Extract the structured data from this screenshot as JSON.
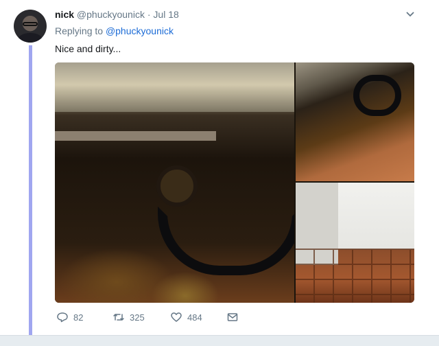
{
  "tweet": {
    "name": "nick",
    "handle": "@phuckyounick",
    "dot": "·",
    "date": "Jul 18",
    "replying_prefix": "Replying to",
    "replying_handle": "@phuckyounick",
    "text": "Nice and dirty...",
    "media": [
      {
        "label": "photo-1"
      },
      {
        "label": "photo-2"
      },
      {
        "label": "photo-3"
      }
    ]
  },
  "actions": {
    "reply_count": "82",
    "retweet_count": "325",
    "like_count": "484"
  },
  "icons": {
    "more": "chevron-down-icon",
    "reply": "reply-icon",
    "retweet": "retweet-icon",
    "like": "heart-icon",
    "dm": "envelope-icon"
  },
  "colors": {
    "link": "#1b6bd6",
    "secondary": "#657786",
    "thread_line": "#a0a6f0"
  }
}
